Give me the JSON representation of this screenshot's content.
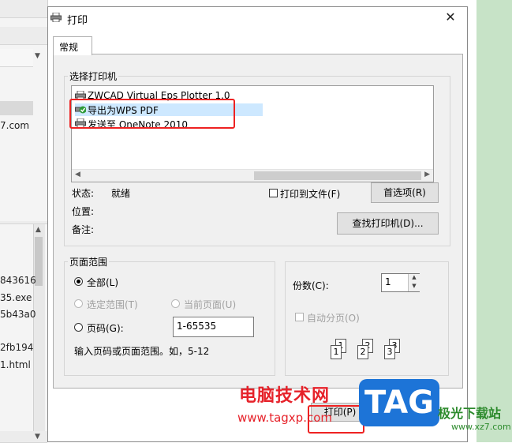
{
  "background": {
    "items": [
      "7.com",
      "843616",
      "35.exe",
      "5b43a0",
      "2fb194",
      "1.html"
    ]
  },
  "dialog": {
    "title": "打印",
    "close": "✕",
    "tab": "常规"
  },
  "printers": {
    "group_label": "选择打印机",
    "items": [
      {
        "name": "ZWCAD Virtual Eps Plotter 1.0",
        "selected": false
      },
      {
        "name": "导出为WPS PDF",
        "selected": true
      },
      {
        "name": "发送至 OneNote 2010",
        "selected": false
      }
    ]
  },
  "status": {
    "status_label": "状态:",
    "status_value": "就绪",
    "location_label": "位置:",
    "comment_label": "备注:",
    "print_to_file": "打印到文件(F)",
    "preferences": "首选项(R)",
    "find_printer": "查找打印机(D)..."
  },
  "page_range": {
    "group_label": "页面范围",
    "all": "全部(L)",
    "selection": "选定范围(T)",
    "current_page": "当前页面(U)",
    "pages": "页码(G):",
    "pages_value": "1-65535",
    "hint": "输入页码或页面范围。如，5-12"
  },
  "copies": {
    "label": "份数(C):",
    "value": "1",
    "collate": "自动分页(O)",
    "pages": [
      "1",
      "1",
      "2",
      "2",
      "3",
      "3"
    ]
  },
  "footer": {
    "print_button": "打印(P)"
  },
  "watermark": {
    "brand": "电脑技术网",
    "url": "www.tagxp.com",
    "tag": "TAG",
    "site": "极光下载站",
    "site_url": "www.xz7.com"
  }
}
